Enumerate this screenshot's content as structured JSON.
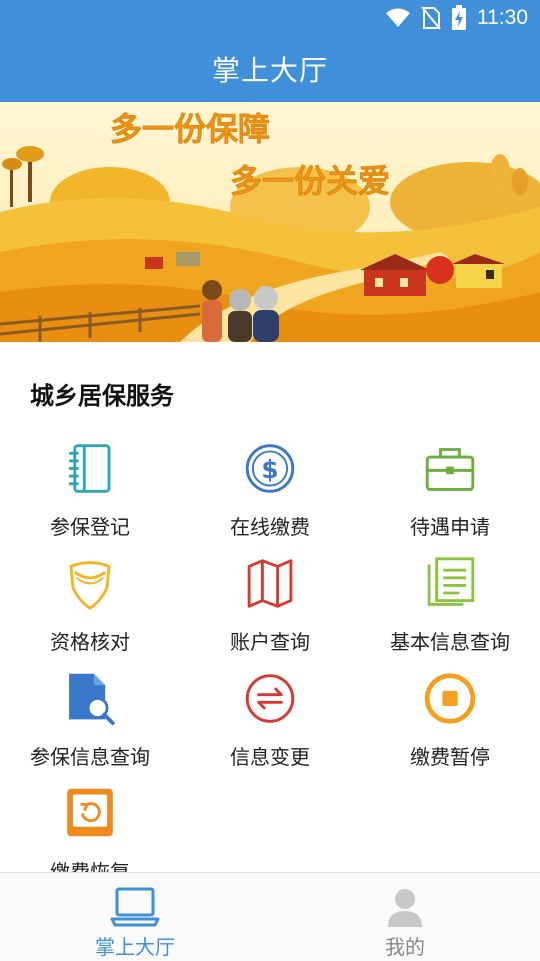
{
  "status_bar": {
    "time": "11:30"
  },
  "app_bar": {
    "title": "掌上大厅"
  },
  "banner": {
    "line1": "多一份保障",
    "line2": "多一份关爱"
  },
  "section": {
    "title": "城乡居保服务"
  },
  "services": [
    {
      "label": "参保登记",
      "icon": "notebook-icon"
    },
    {
      "label": "在线缴费",
      "icon": "dollar-coin-icon"
    },
    {
      "label": "待遇申请",
      "icon": "briefcase-icon"
    },
    {
      "label": "资格核对",
      "icon": "shield-icon"
    },
    {
      "label": "账户查询",
      "icon": "map-icon"
    },
    {
      "label": "基本信息查询",
      "icon": "document-icon"
    },
    {
      "label": "参保信息查询",
      "icon": "file-search-icon"
    },
    {
      "label": "信息变更",
      "icon": "swap-arrows-icon"
    },
    {
      "label": "缴费暂停",
      "icon": "stop-icon"
    },
    {
      "label": "缴费恢复",
      "icon": "restore-icon"
    }
  ],
  "bottom_nav": [
    {
      "label": "掌上大厅",
      "active": true
    },
    {
      "label": "我的",
      "active": false
    }
  ],
  "colors": {
    "primary": "#3f8fd9",
    "teal": "#2aa6b8",
    "red": "#d9382e",
    "green": "#8ac43f",
    "orange": "#f5a01c",
    "blue": "#3877c9"
  }
}
